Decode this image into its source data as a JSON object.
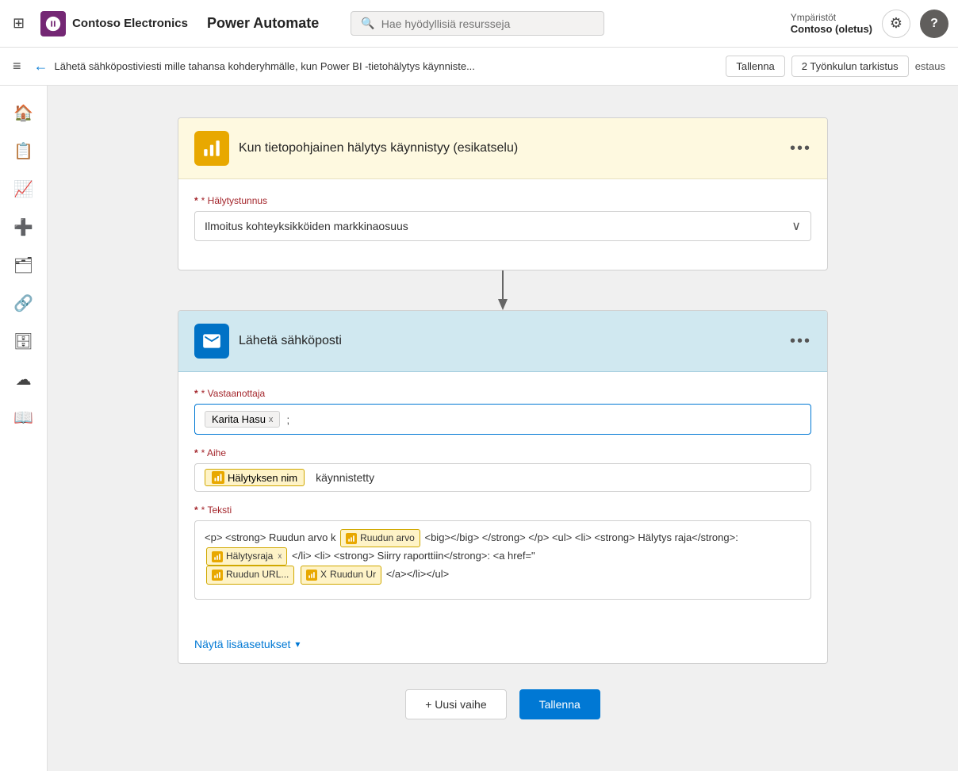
{
  "app": {
    "grid_icon": "⊞",
    "logo_text": "Contoso Electronics",
    "app_name": "Power Automate",
    "search_placeholder": "Hae hyödyllisiä resursseja"
  },
  "nav_right": {
    "environment_label": "Ympäristöt",
    "environment_name": "Contoso (oletus)",
    "settings_icon": "⚙",
    "help_icon": "?"
  },
  "toolbar": {
    "menu_label": "≡",
    "back_label": "←",
    "breadcrumb": "Lähetä sähköpostiviesti mille tahansa kohderyhmälle, kun Power BI -tietohälytys käynniste...",
    "save_label": "Tallenna",
    "check_label": "2 Työnkulun tarkistus",
    "status_label": "estaus"
  },
  "trigger_card": {
    "icon_symbol": "📊",
    "title": "Kun tietopohjainen hälytys käynnistyy (esikatselu)",
    "dots": "•••",
    "field_label": "* Hälytystunnus",
    "field_value": "Ilmoitus kohteyksikköiden markkinaosuus",
    "required_star": "*"
  },
  "email_card": {
    "icon_symbol": "✉",
    "title": "Lähetä sähköposti",
    "dots": "•••",
    "recipient_label": "* Vastaanottaja",
    "recipient_tag": "Karita Hasu",
    "recipient_separator": ";",
    "subject_label": "* Aihe",
    "subject_prefix": "Hälytyksen nim",
    "subject_suffix": "käynnistetty",
    "body_label": "* Teksti",
    "body_html_start": "<p> <strong> Ruudun arvo k",
    "body_badge1_text": "Ruudun arvo",
    "body_html_mid1": "<big></big> </strong> </p> <ul> <li> <strong> Hälytys raja</strong>:",
    "body_badge2_text": "Hälytysraja",
    "body_html_mid2": "</li> <li> <strong> Siirry raporttiin</strong>: <a href=\"",
    "body_badge3_text": "Ruudun URL...",
    "body_badge3b_text": "Ruudun Ur",
    "body_html_end": "</a></li></ul>",
    "show_more_label": "Näytä lisäasetukset",
    "show_more_icon": "▾"
  },
  "bottom_actions": {
    "new_step_label": "+ Uusi vaihe",
    "save_label": "Tallenna"
  },
  "sidebar": {
    "items": [
      {
        "icon": "🏠",
        "name": "home"
      },
      {
        "icon": "📋",
        "name": "flows"
      },
      {
        "icon": "📈",
        "name": "analytics"
      },
      {
        "icon": "➕",
        "name": "create"
      },
      {
        "icon": "🗂",
        "name": "templates"
      },
      {
        "icon": "🔗",
        "name": "connectors"
      },
      {
        "icon": "🗄",
        "name": "data"
      },
      {
        "icon": "☁",
        "name": "monitor"
      },
      {
        "icon": "📖",
        "name": "learn"
      }
    ]
  }
}
